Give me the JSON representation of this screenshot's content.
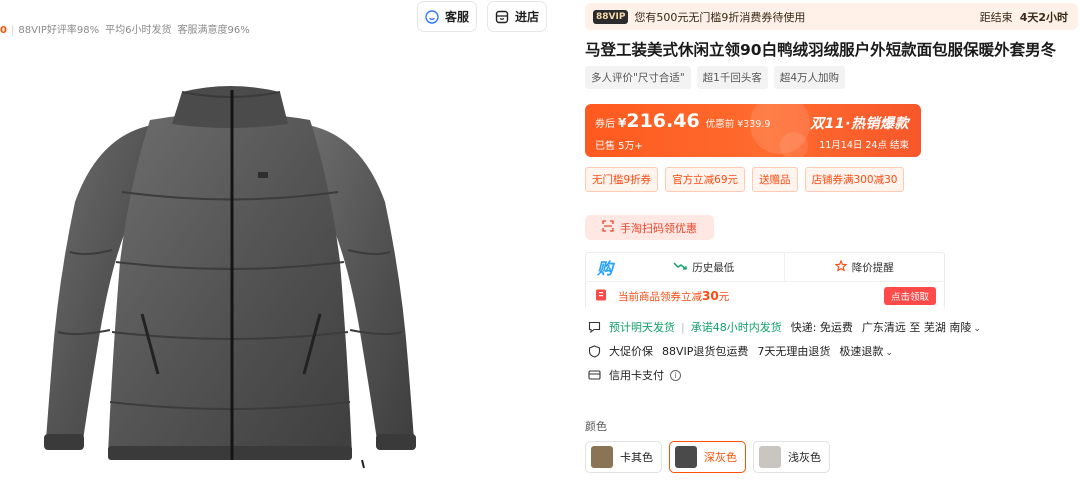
{
  "shop": {
    "score": "0",
    "stats": [
      "88VIP好评率98%",
      "平均6小时发货",
      "客服满意度96%"
    ],
    "service_label": "客服",
    "store_label": "进店"
  },
  "vip_banner": {
    "tag": "88VIP",
    "text": "您有500元无门槛9折消费券待使用",
    "countdown_prefix": "距结束",
    "countdown_value": "4天2小时"
  },
  "product": {
    "title": "马登工装美式休闲立领90白鸭绒羽绒服户外短款面包服保暖外套男冬",
    "tags": [
      "多人评价\"尺寸合适\"",
      "超1千回头客",
      "超4万人加购"
    ]
  },
  "price": {
    "prefix": "券后",
    "currency": "¥",
    "value": "216.46",
    "original": "优惠前 ¥339.9",
    "sold": "已售  5万+",
    "promo_title": "双11·热销爆款",
    "promo_end": "11月14日 24点  结束",
    "colors": {
      "bg_start": "#ff5a1f",
      "bg_end": "#f7572a"
    }
  },
  "coupons": [
    "无门槛9折券",
    "官方立减69元",
    "送赠品",
    "店铺券满300减30"
  ],
  "scan_button": "手淘扫码领优惠",
  "tools": {
    "logo": "购",
    "history_low": "历史最低",
    "price_alert": "降价提醒",
    "coupon_prefix": "当前商品领券立减",
    "coupon_amount": "30",
    "coupon_suffix": "元",
    "claim_label": "点击领取"
  },
  "services": {
    "ship": "预计明天发货",
    "promise": "承诺48小时内发货",
    "express": "快递: 免运费",
    "route": "广东清远 至 芜湖 南陵",
    "price_protect": "大促价保",
    "return_ship": "88VIP退货包运费",
    "no_reason": "7天无理由退货",
    "fast_refund": "极速退款",
    "credit": "信用卡支付"
  },
  "colors_section": {
    "label": "颜色",
    "options": [
      {
        "name": "卡其色",
        "selected": false,
        "swatch": "#8b7355"
      },
      {
        "name": "深灰色",
        "selected": true,
        "swatch": "#4a4a4a"
      },
      {
        "name": "浅灰色",
        "selected": false,
        "swatch": "#c9c6c2"
      }
    ]
  },
  "theme": {
    "accent": "#ff5000",
    "green": "#11a06a"
  }
}
